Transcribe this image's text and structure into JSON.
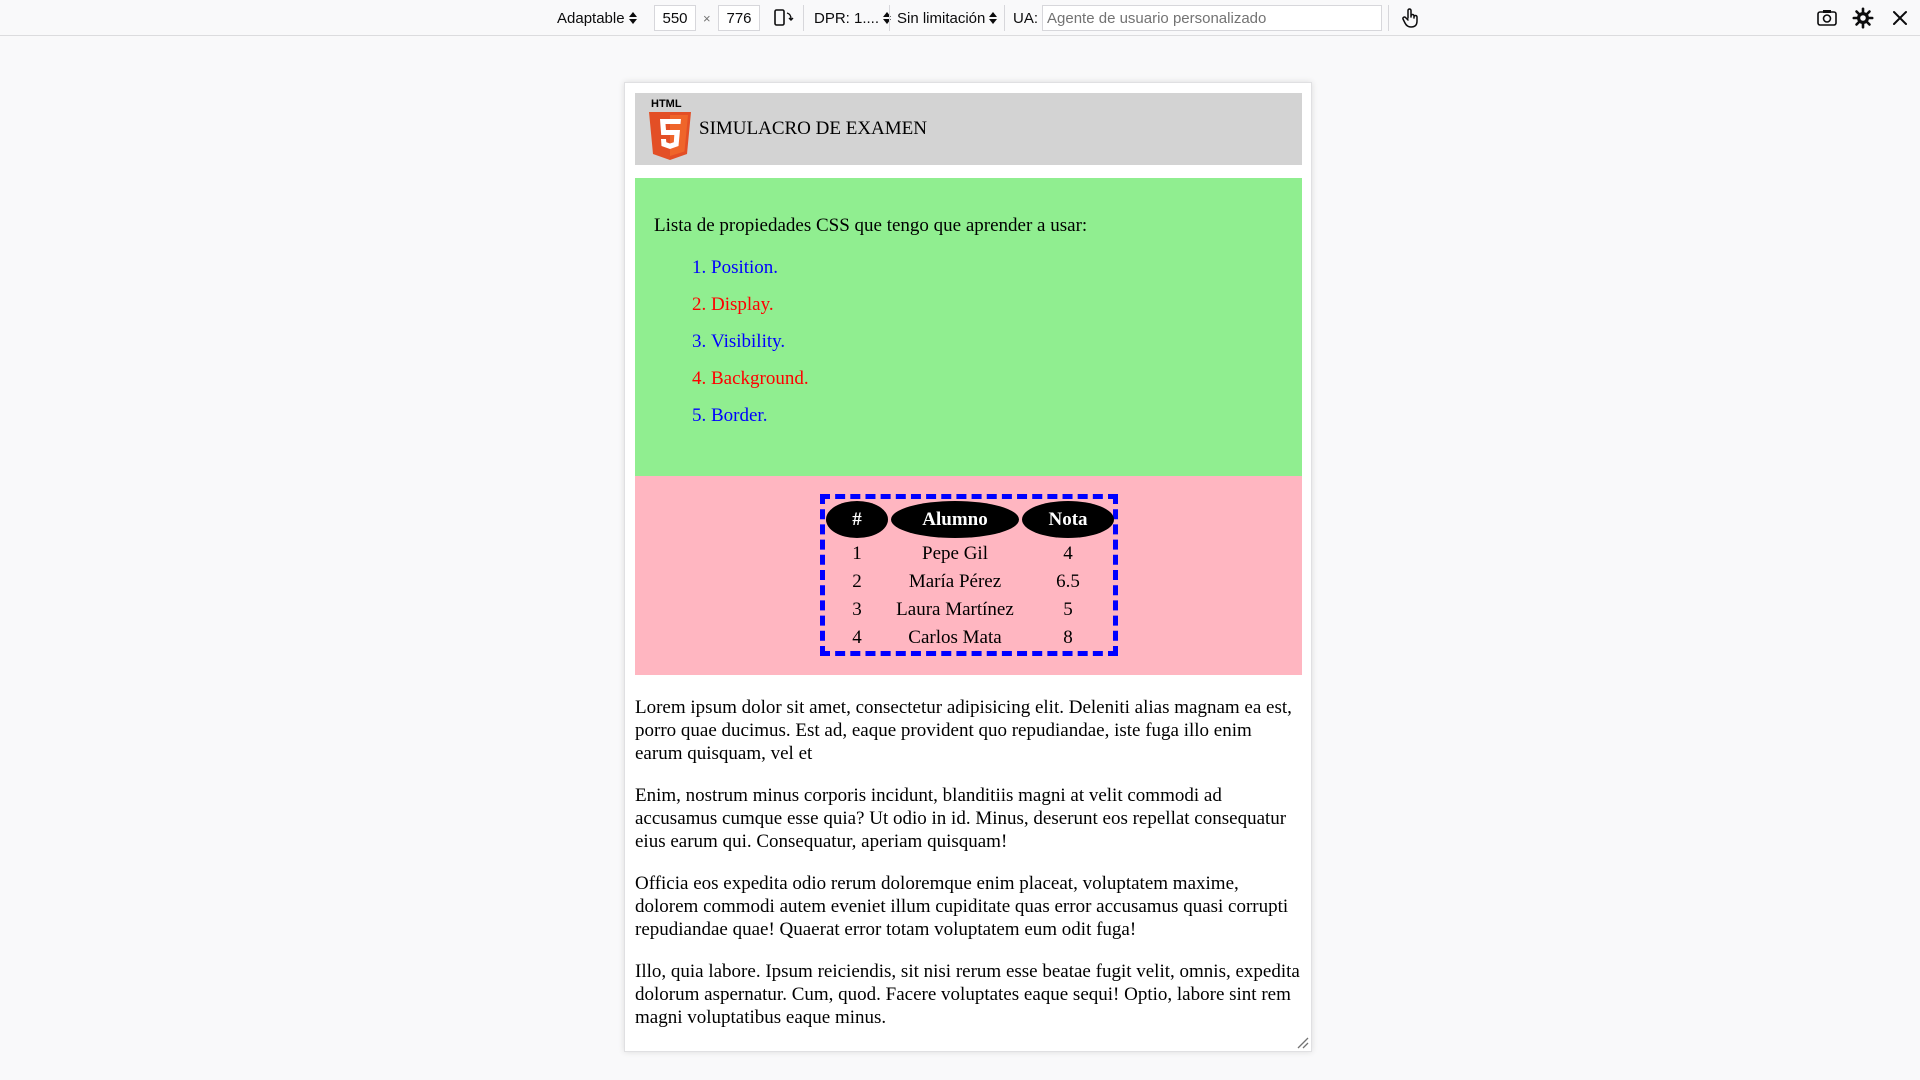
{
  "toolbar": {
    "device": "Adaptable",
    "width": "550",
    "times": "×",
    "height": "776",
    "dpr": "DPR: 1....",
    "throttle": "Sin limitación",
    "ua_label": "UA:",
    "ua_placeholder": "Agente de usuario personalizado"
  },
  "page": {
    "logo_text": "HTML",
    "logo_digit": "5",
    "title": "SIMULACRO DE EXAMEN",
    "list_intro": "Lista de propiedades CSS que tengo que aprender a usar:",
    "list_items": [
      {
        "label": "Position.",
        "color": "#0000ff"
      },
      {
        "label": "Display.",
        "color": "#ff0000"
      },
      {
        "label": "Visibility.",
        "color": "#0000ff"
      },
      {
        "label": "Background.",
        "color": "#ff0000"
      },
      {
        "label": "Border.",
        "color": "#0000ff"
      }
    ],
    "table": {
      "headers": [
        "#",
        "Alumno",
        "Nota"
      ],
      "rows": [
        [
          "1",
          "Pepe Gil",
          "4"
        ],
        [
          "2",
          "María Pérez",
          "6.5"
        ],
        [
          "3",
          "Laura Martínez",
          "5"
        ],
        [
          "4",
          "Carlos Mata",
          "8"
        ]
      ]
    },
    "paragraphs": [
      "Lorem ipsum dolor sit amet, consectetur adipisicing elit. Deleniti alias magnam ea est, porro quae ducimus. Est ad, eaque provident quo repudiandae, iste fuga illo enim earum quisquam, vel et",
      "Enim, nostrum minus corporis incidunt, blanditiis magni at velit commodi ad accusamus cumque esse quia? Ut odio in id. Minus, deserunt eos repellat consequatur eius earum qui. Consequatur, aperiam quisquam!",
      "Officia eos expedita odio rerum doloremque enim placeat, voluptatem maxime, dolorem commodi autem eveniet illum cupiditate quas error accusamus quasi corrupti repudiandae quae! Quaerat error totam voluptatem eum odit fuga!",
      "Illo, quia labore. Ipsum reiciendis, sit nisi rerum esse beatae fugit velit, omnis, expedita dolorum aspernatur. Cum, quod. Facere voluptates eaque sequi! Optio, labore sint rem magni voluptatibus eaque minus."
    ]
  },
  "colors": {
    "header_bg": "#d3d3d3",
    "list_bg": "#90ee90",
    "table_bg": "#ffb6c1",
    "table_border": "#0000ff",
    "logo_orange": "#e34f26"
  },
  "icons": [
    "rotate-icon",
    "touch-icon",
    "screenshot-icon",
    "settings-icon",
    "close-icon",
    "resize-handle-icon",
    "html5-logo"
  ]
}
